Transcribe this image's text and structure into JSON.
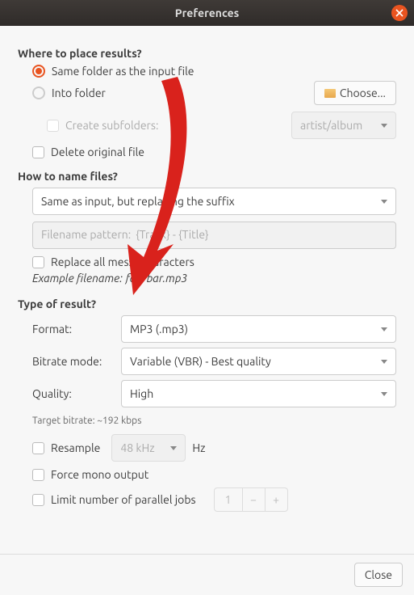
{
  "window": {
    "title": "Preferences",
    "close_button": "Close"
  },
  "placement": {
    "heading": "Where to place results?",
    "same_folder": "Same folder as the input file",
    "into_folder": "Into folder",
    "choose": "Choose...",
    "create_subfolders": "Create subfolders:",
    "subfolder_pattern": "artist/album",
    "delete_original": "Delete original file"
  },
  "naming": {
    "heading": "How to name files?",
    "mode": "Same as input, but replacing the suffix",
    "pattern_label": "Filename pattern:",
    "pattern_value": "{Track} - {Title}",
    "replace_messy": "Replace all messy characters",
    "example_label": "Example filename:",
    "example_value": "foo/bar.mp3"
  },
  "result": {
    "heading": "Type of result?",
    "format_label": "Format:",
    "format_value": "MP3 (.mp3)",
    "bitrate_mode_label": "Bitrate mode:",
    "bitrate_mode_value": "Variable (VBR) - Best quality",
    "quality_label": "Quality:",
    "quality_value": "High",
    "target_bitrate": "Target bitrate: ~192 kbps",
    "resample": "Resample",
    "resample_value": "48 kHz",
    "hz": "Hz",
    "force_mono": "Force mono output",
    "limit_jobs": "Limit number of parallel jobs",
    "jobs_value": "1"
  }
}
